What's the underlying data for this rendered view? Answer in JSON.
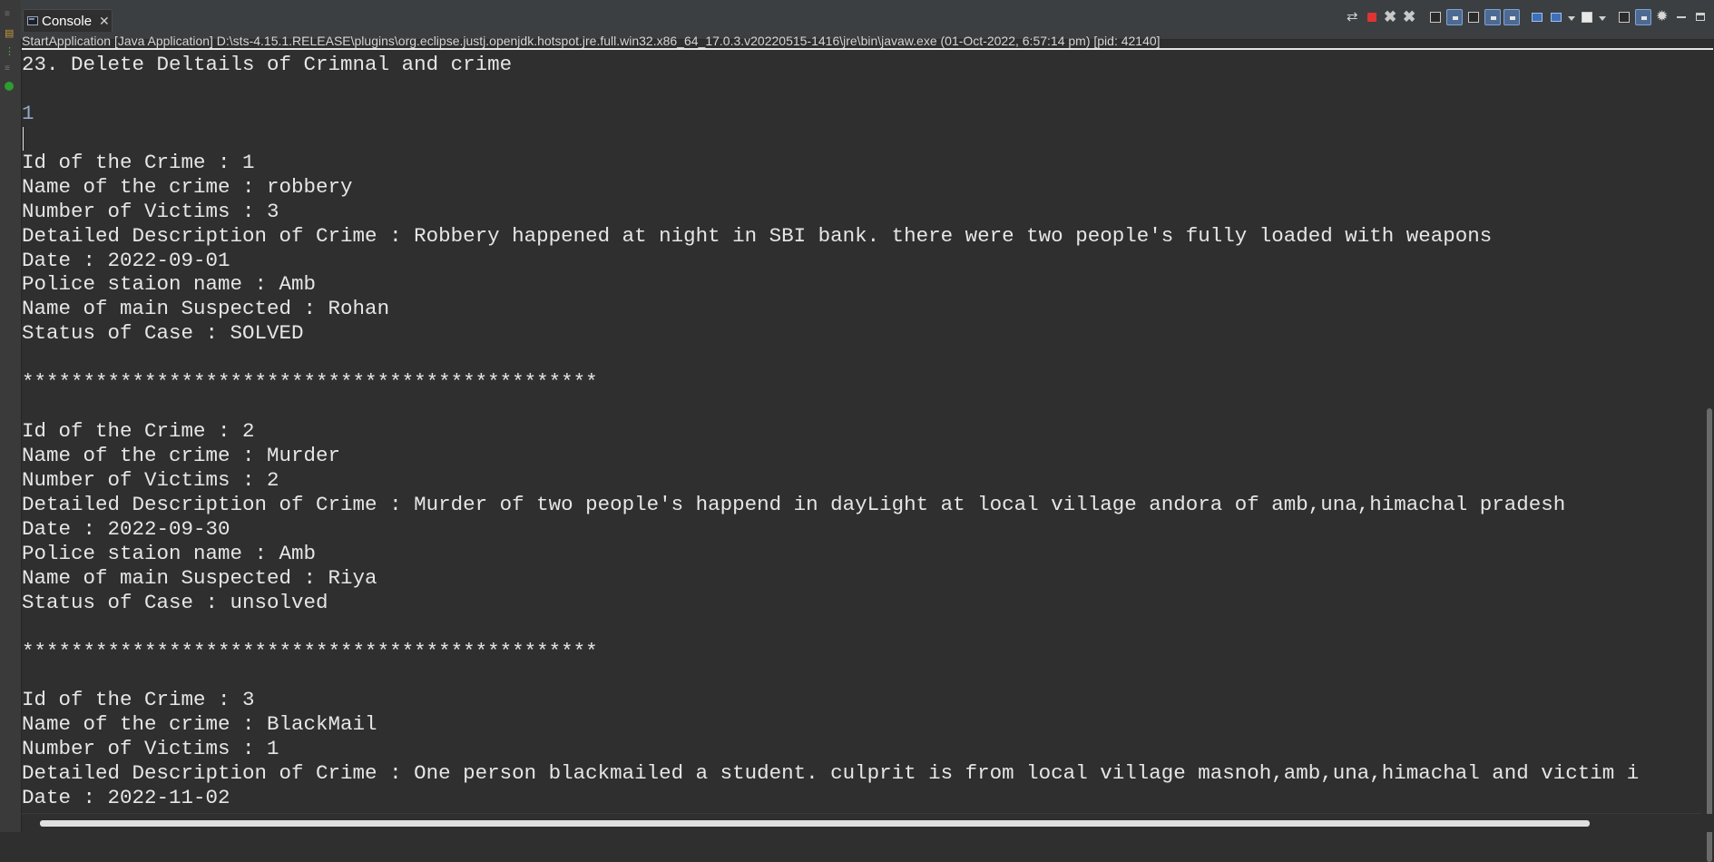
{
  "tab": {
    "label": "Console",
    "close_glyph": "✕",
    "icon": "console-icon"
  },
  "process_line": "StartApplication [Java Application] D:\\sts-4.15.1.RELEASE\\plugins\\org.eclipse.justj.openjdk.hotspot.jre.full.win32.x86_64_17.0.3.v20220515-1416\\jre\\bin\\javaw.exe  (01-Oct-2022, 6:57:14 pm) [pid: 42140]",
  "toolbar": {
    "icons": [
      "remove-launch-icon",
      "terminate-icon",
      "remove-all-terminated-icon",
      "clear-console-icon",
      "scroll-lock-icon",
      "word-wrap-icon",
      "show-stdout-icon",
      "show-stderr-icon",
      "pin-console-icon",
      "display-console-icon",
      "new-console-icon",
      "open-console-icon",
      "copy-icon",
      "word-wrap-active-icon",
      "settings-icon",
      "minimize-icon",
      "maximize-icon"
    ]
  },
  "console": {
    "lines": [
      {
        "text": "23. Delete Deltails of Crimnal and crime",
        "kind": "output"
      },
      {
        "text": "",
        "kind": "output"
      },
      {
        "text": "1",
        "kind": "input"
      },
      {
        "text": "",
        "kind": "output"
      },
      {
        "text": "Id of the Crime : 1",
        "kind": "output"
      },
      {
        "text": "Name of the crime : robbery",
        "kind": "output"
      },
      {
        "text": "Number of Victims : 3",
        "kind": "output"
      },
      {
        "text": "Detailed Description of Crime : Robbery happened at night in SBI bank. there were two people's fully loaded with weapons",
        "kind": "output"
      },
      {
        "text": "Date : 2022-09-01",
        "kind": "output"
      },
      {
        "text": "Police staion name : Amb",
        "kind": "output"
      },
      {
        "text": "Name of main Suspected : Rohan",
        "kind": "output"
      },
      {
        "text": "Status of Case : SOLVED",
        "kind": "output"
      },
      {
        "text": "",
        "kind": "output"
      },
      {
        "text": "***********************************************",
        "kind": "output"
      },
      {
        "text": "",
        "kind": "output"
      },
      {
        "text": "Id of the Crime : 2",
        "kind": "output"
      },
      {
        "text": "Name of the crime : Murder",
        "kind": "output"
      },
      {
        "text": "Number of Victims : 2",
        "kind": "output"
      },
      {
        "text": "Detailed Description of Crime : Murder of two people's happend in dayLight at local village andora of amb,una,himachal pradesh",
        "kind": "output"
      },
      {
        "text": "Date : 2022-09-30",
        "kind": "output"
      },
      {
        "text": "Police staion name : Amb",
        "kind": "output"
      },
      {
        "text": "Name of main Suspected : Riya",
        "kind": "output"
      },
      {
        "text": "Status of Case : unsolved",
        "kind": "output"
      },
      {
        "text": "",
        "kind": "output"
      },
      {
        "text": "***********************************************",
        "kind": "output"
      },
      {
        "text": "",
        "kind": "output"
      },
      {
        "text": "Id of the Crime : 3",
        "kind": "output"
      },
      {
        "text": "Name of the crime : BlackMail",
        "kind": "output"
      },
      {
        "text": "Number of Victims : 1",
        "kind": "output"
      },
      {
        "text": "Detailed Description of Crime : One person blackmailed a student. culprit is from local village masnoh,amb,una,himachal and victim i",
        "kind": "output"
      },
      {
        "text": "Date : 2022-11-02",
        "kind": "output"
      }
    ]
  },
  "colors": {
    "background": "#2f2f2f",
    "output_text": "#e6e6e6",
    "input_text": "#8fa9c7",
    "terminate_red": "#e03333"
  },
  "scroll": {
    "vertical_position_fraction": 0.42,
    "horizontal_position_fraction": 0.0
  }
}
